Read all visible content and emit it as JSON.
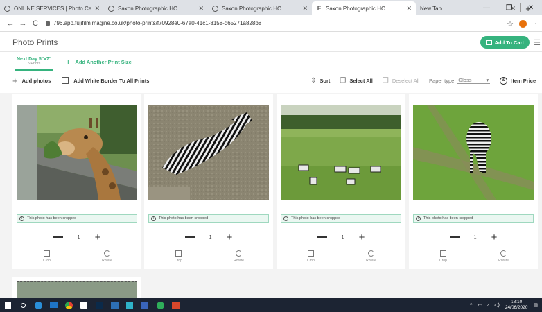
{
  "browser": {
    "tabs": [
      {
        "title": "ONLINE SERVICES | Photo Cent",
        "favicon": "globe-icon",
        "active": false
      },
      {
        "title": "Saxon Photographic HO",
        "favicon": "globe-icon",
        "active": false
      },
      {
        "title": "Saxon Photographic HO",
        "favicon": "globe-icon",
        "active": false
      },
      {
        "title": "Saxon Photographic HO",
        "favicon": "fujifilm-f-icon",
        "active": true
      },
      {
        "title": "New Tab",
        "favicon": "",
        "active": false
      }
    ],
    "url": "796.app.fujifilmimagine.co.uk/photo-prints/f70928e0-67a0-41c1-8158-d65271a828b8",
    "favicon_letter": "F"
  },
  "page": {
    "title": "Photo Prints",
    "cart_label": "Add To Cart",
    "accent": "#36b37e"
  },
  "size_tabs": {
    "active": {
      "name": "Next Day 5\"x7\"",
      "count": "5 Prints"
    },
    "add_label": "Add Another Print Size"
  },
  "toolbar": {
    "add_photos": "Add photos",
    "white_border": "Add White Border To All Prints",
    "sort": "Sort",
    "select_all": "Select All",
    "deselect_all": "Deselect All",
    "paper_type_label": "Paper type",
    "paper_type_value": "Gloss",
    "item_price": "Item Price"
  },
  "photos": [
    {
      "subject": "giraffe",
      "notice": "This photo has been cropped",
      "qty": "1",
      "crop": "Crop",
      "rotate": "Rotate"
    },
    {
      "subject": "zebra lying",
      "notice": "This photo has been cropped",
      "qty": "1",
      "crop": "Crop",
      "rotate": "Rotate"
    },
    {
      "subject": "zebra herd",
      "notice": "This photo has been cropped",
      "qty": "1",
      "crop": "Crop",
      "rotate": "Rotate"
    },
    {
      "subject": "zebra grazing",
      "notice": "This photo has been cropped",
      "qty": "1",
      "crop": "Crop",
      "rotate": "Rotate"
    }
  ],
  "taskbar": {
    "time": "18:10",
    "date": "24/06/2020"
  }
}
